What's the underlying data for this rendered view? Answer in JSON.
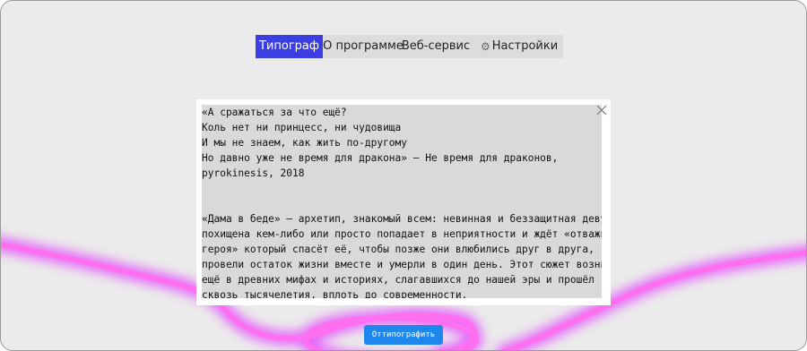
{
  "nav": {
    "items": [
      {
        "label": "Типограф",
        "active": true
      },
      {
        "label": "О программе",
        "active": false
      },
      {
        "label": "Веб-сервис",
        "active": false
      },
      {
        "label": "Настройки",
        "active": false,
        "icon": "gear-icon"
      }
    ]
  },
  "editor": {
    "text": "«А сражаться за что ещё?\nКоль нет ни принцесс, ни чудовища\nИ мы не знаем, как жить по-другому\nНо давно уже не время для дракона» — Не время для драконов,\npyrokinesis, 2018\n\n\n«Дама в беде» — архетип, знакомый всем: невинная и беззащитная девушка\nпохищена кем-либо или просто попадает в неприятности и ждёт «отважного\nгероя» который спасёт её, чтобы позже они влюбились друг в друга,\nпровели остаток жизни вместе и умерли в один день. Этот сюжет возник\nещё в древних мифах и историях, слагавшихся до нашей эры и прошёл\nсквозь тысячелетия, вплоть до современности.",
    "clear_icon": "close-icon"
  },
  "actions": {
    "submit_label": "Оттипографить"
  },
  "colors": {
    "accent": "#3b3ee0",
    "button": "#1f86ec",
    "glow": "#ff3cf0"
  }
}
